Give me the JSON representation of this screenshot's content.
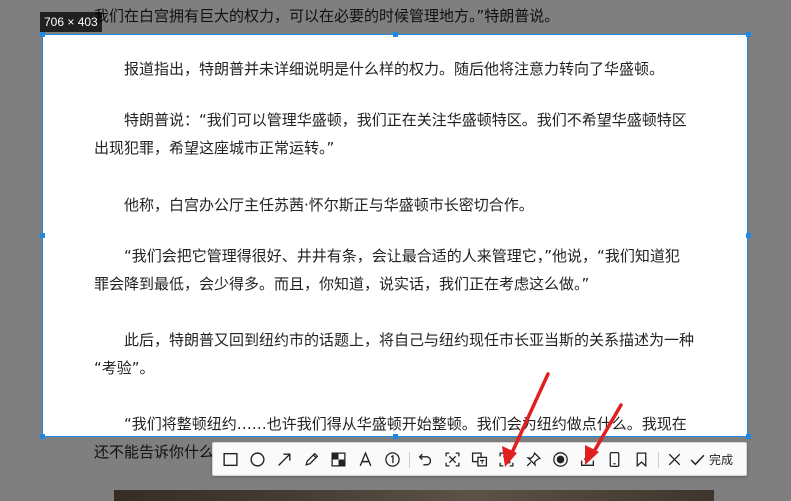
{
  "article": {
    "paragraphs": [
      {
        "lines": [
          "我们在白宫拥有巨大的权力，可以在必要的时候管理地方。”特朗普说。"
        ]
      },
      {
        "lines": [
          "　　报道指出，特朗普并未详细说明是什么样的权力。随后他将注意力转向了华盛顿。"
        ]
      },
      {
        "lines": [
          "　　特朗普说：“我们可以管理华盛顿，我们正在关注华盛顿特区。我们不希望华盛顿特区",
          "出现犯罪，希望这座城市正常运转。”"
        ]
      },
      {
        "lines": [
          "　　他称，白宫办公厅主任苏茜·怀尔斯正与华盛顿市长密切合作。"
        ]
      },
      {
        "lines": [
          "　　“我们会把它管理得很好、井井有条，会让最合适的人来管理它，”他说，“我们知道犯",
          "罪会降到最低，会少得多。而且，你知道，说实话，我们正在考虑这么做。”"
        ]
      },
      {
        "lines": [
          "　　此后，特朗普又回到纽约市的话题上，将自己与纽约现任市长亚当斯的关系描述为一种",
          "“考验”。"
        ]
      },
      {
        "lines": [
          "　　“我们将整顿纽约……也许我们得从华盛顿开始整顿。我们会为纽约做点什么。我现在",
          "还不能告诉你什么"
        ]
      }
    ]
  },
  "selection": {
    "size_label": "706 × 403"
  },
  "toolbar": {
    "tools": [
      {
        "name": "rectangle-tool",
        "icon": "rectangle-icon"
      },
      {
        "name": "ellipse-tool",
        "icon": "ellipse-icon"
      },
      {
        "name": "arrow-tool",
        "icon": "arrow-icon"
      },
      {
        "name": "pencil-tool",
        "icon": "pencil-icon"
      },
      {
        "name": "mosaic-tool",
        "icon": "mosaic-icon"
      },
      {
        "name": "text-tool",
        "icon": "text-icon"
      },
      {
        "name": "number-marker-tool",
        "icon": "numbered-circle-icon"
      },
      {
        "name": "undo-button",
        "icon": "undo-icon"
      },
      {
        "name": "ocr-button",
        "icon": "ocr-icon"
      },
      {
        "name": "translate-button",
        "icon": "translate-icon"
      },
      {
        "name": "long-screenshot-button",
        "icon": "long-screenshot-icon"
      },
      {
        "name": "pin-button",
        "icon": "pin-icon"
      },
      {
        "name": "record-button",
        "icon": "record-icon"
      },
      {
        "name": "download-button",
        "icon": "download-icon"
      },
      {
        "name": "phone-button",
        "icon": "phone-icon"
      },
      {
        "name": "bookmark-button",
        "icon": "bookmark-icon"
      },
      {
        "name": "cancel-button",
        "icon": "close-icon"
      }
    ],
    "done_label": "完成"
  },
  "colors": {
    "selection_border": "#1e88e5",
    "annotation_red": "#e02020",
    "dim_overlay": "rgba(0,0,0,0.5)"
  }
}
